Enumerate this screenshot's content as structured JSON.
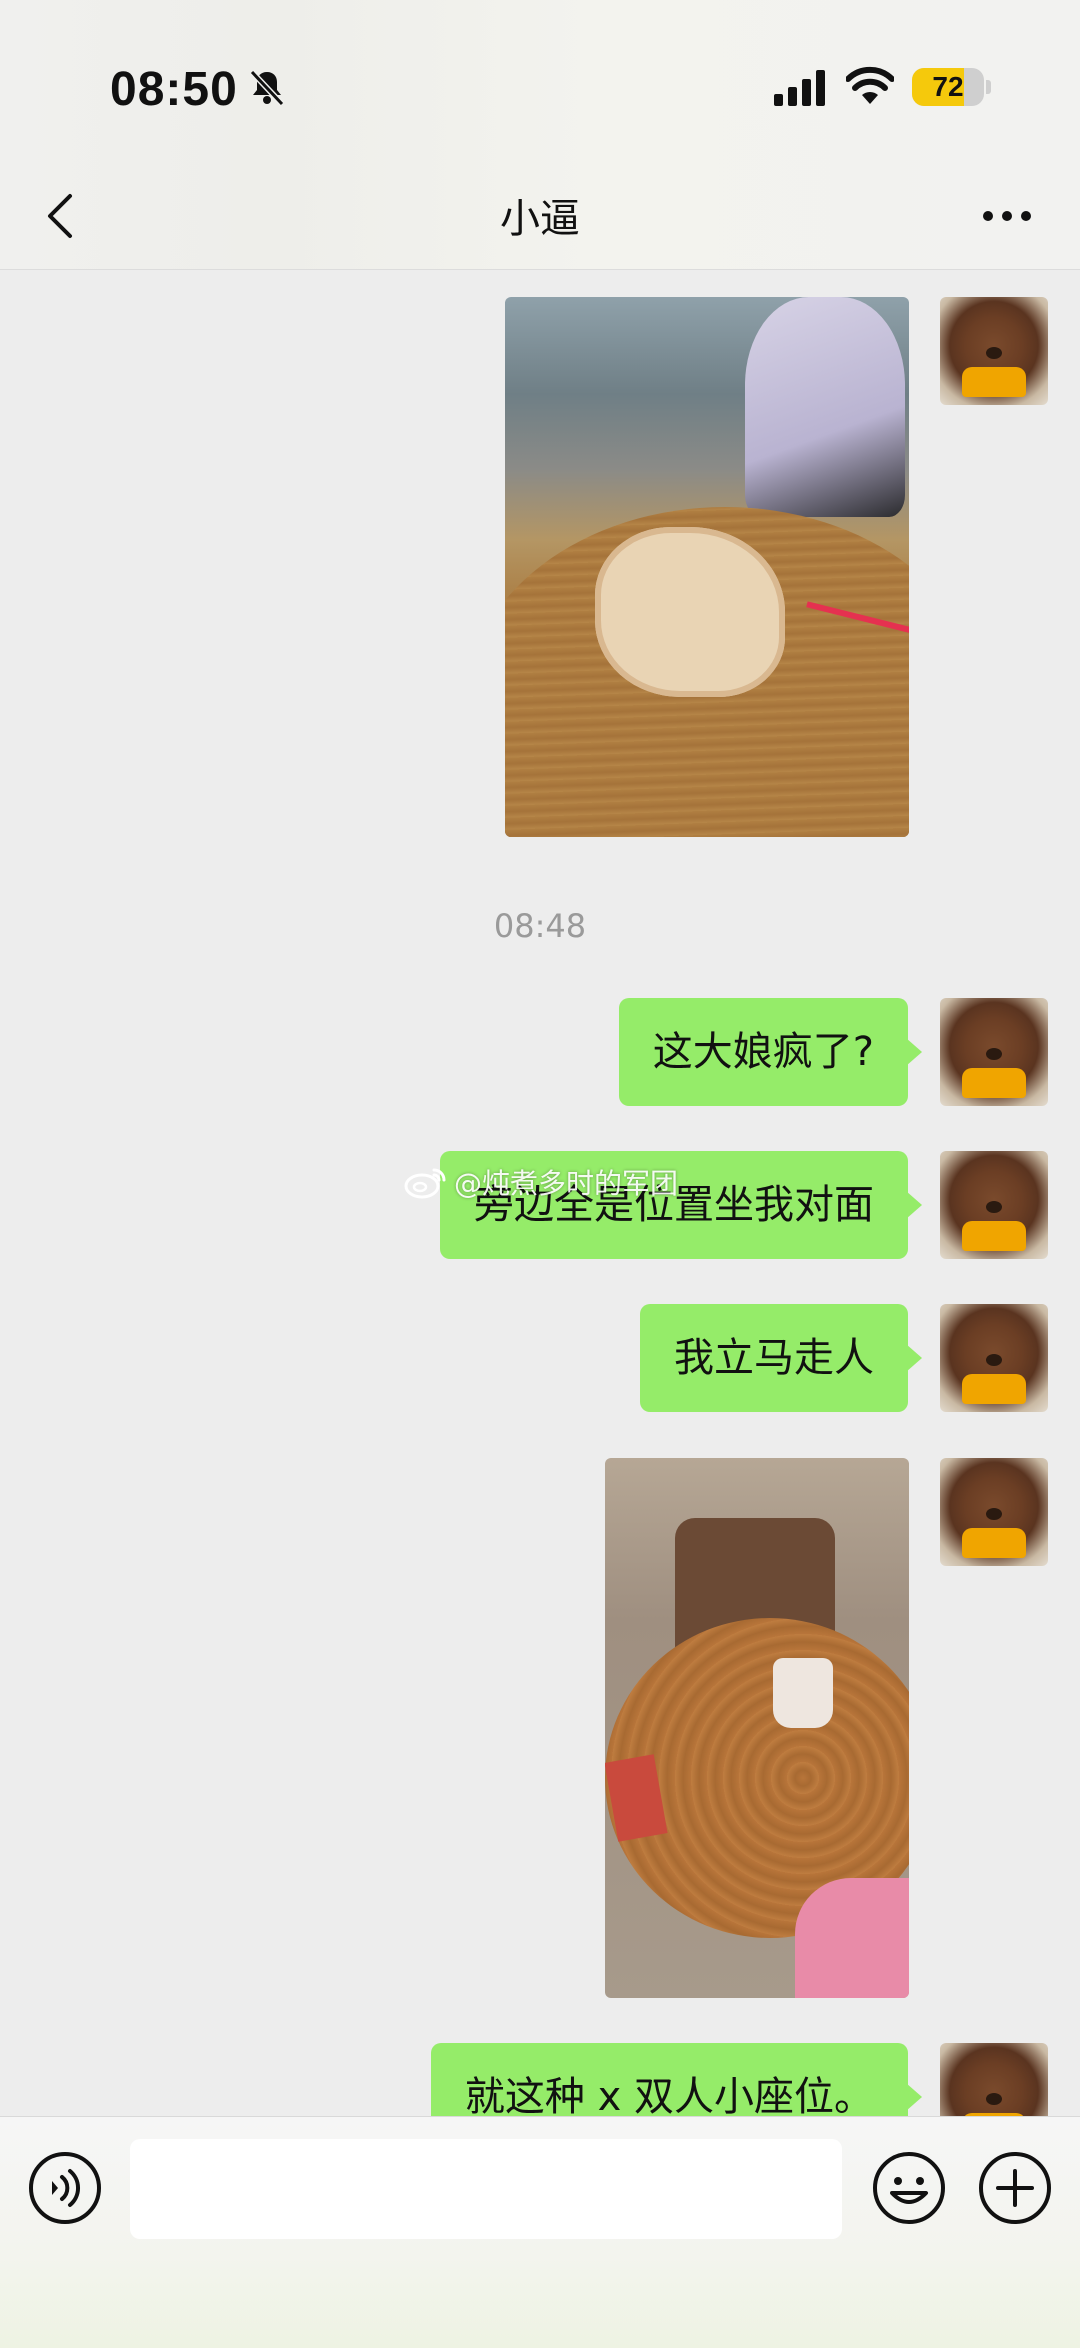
{
  "status_bar": {
    "time": "08:50",
    "battery_level": 72,
    "battery_label": "72"
  },
  "header": {
    "title": "小逼"
  },
  "chat": {
    "timestamp": "08:48",
    "messages": [
      {
        "type": "image",
        "description_icon": "photo-table-bag"
      },
      {
        "type": "text",
        "text": "这大娘疯了?"
      },
      {
        "type": "text",
        "text": "旁边全是位置坐我对面"
      },
      {
        "type": "text",
        "text": "我立马走人"
      },
      {
        "type": "image",
        "description_icon": "photo-table-cup"
      },
      {
        "type": "text",
        "text": "就这种 x 双人小座位。"
      }
    ]
  },
  "watermark": {
    "text": "@炖煮多时的军团"
  },
  "input_bar": {
    "placeholder": ""
  },
  "colors": {
    "bubble": "#95ec69",
    "background": "#ededed",
    "battery": "#f5c90c"
  }
}
